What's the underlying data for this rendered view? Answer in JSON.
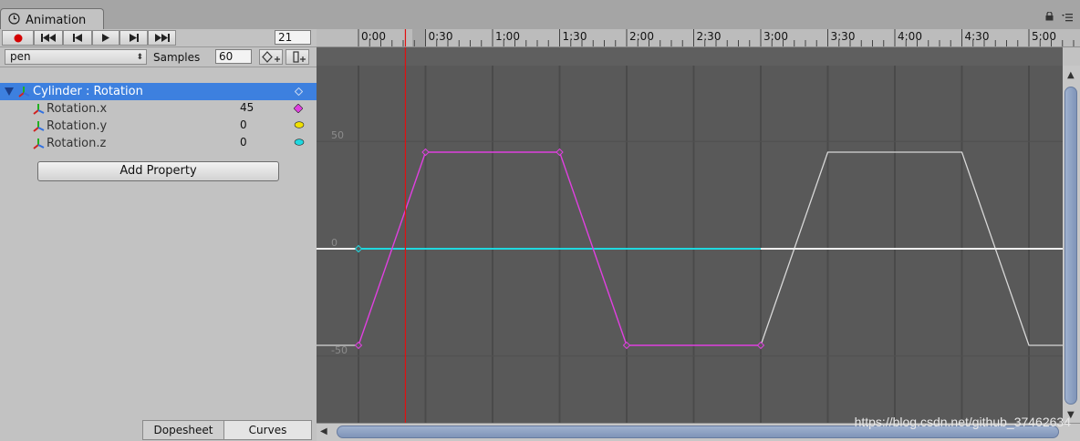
{
  "window": {
    "tab_title": "Animation"
  },
  "toolbar": {
    "frame": "21"
  },
  "clip": {
    "selected": "pen",
    "samples_label": "Samples",
    "samples": "60"
  },
  "properties": {
    "group": "Cylinder : Rotation",
    "items": [
      {
        "label": "Rotation.x",
        "value": "45",
        "color": "#e040e0"
      },
      {
        "label": "Rotation.y",
        "value": "0",
        "color": "#f0e000"
      },
      {
        "label": "Rotation.z",
        "value": "0",
        "color": "#20d8e0"
      }
    ]
  },
  "add_property_label": "Add Property",
  "bottom_tabs": [
    "Dopesheet",
    "Curves"
  ],
  "timeline": {
    "ticks": [
      "0:00",
      "0:30",
      "1:00",
      "1:30",
      "2:00",
      "2:30",
      "3:00",
      "3:30",
      "4:00",
      "4:30",
      "5:00"
    ],
    "playhead_frame": 21
  },
  "curves": {
    "y_labels": [
      "50",
      "0",
      "-50"
    ],
    "x_keys": [
      [
        0,
        -45
      ],
      [
        30,
        45
      ],
      [
        90,
        45
      ],
      [
        120,
        -45
      ],
      [
        180,
        -45
      ]
    ],
    "z_keys": [
      [
        0,
        0
      ],
      [
        180,
        0
      ]
    ],
    "loop_pattern": [
      [
        0,
        -45
      ],
      [
        30,
        45
      ],
      [
        90,
        45
      ],
      [
        120,
        -45
      ],
      [
        180,
        -45
      ]
    ],
    "loop_range": [
      180,
      450
    ]
  },
  "colors": {
    "selection": "#3d80df",
    "curve_x": "#e040e0",
    "curve_z": "#20d8e0",
    "playhead": "#e01010",
    "curve_loop": "#d8d8d8"
  },
  "watermark": "https://blog.csdn.net/github_37462634"
}
